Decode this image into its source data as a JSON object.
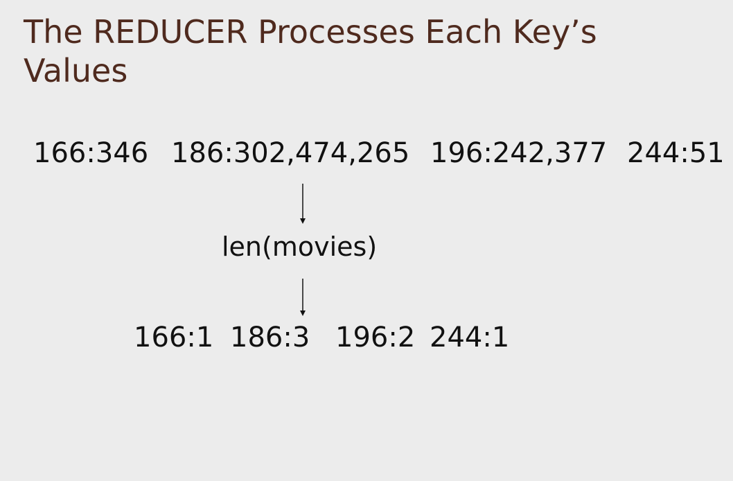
{
  "slide": {
    "title": "The REDUCER Processes Each Key’s Values"
  },
  "diagram": {
    "input": [
      {
        "key": "166",
        "values": "346",
        "text": "166:346"
      },
      {
        "key": "186",
        "values": "302,474,265",
        "text": "186:302,474,265"
      },
      {
        "key": "196",
        "values": "242,377",
        "text": "196:242,377"
      },
      {
        "key": "244",
        "values": "51",
        "text": "244:51"
      }
    ],
    "function_label": "len(movies)",
    "output": [
      {
        "key": "166",
        "count": "1",
        "text": "166:1"
      },
      {
        "key": "186",
        "count": "3",
        "text": "186:3"
      },
      {
        "key": "196",
        "count": "2",
        "text": "196:2"
      },
      {
        "key": "244",
        "count": "1",
        "text": "244:1"
      }
    ]
  }
}
